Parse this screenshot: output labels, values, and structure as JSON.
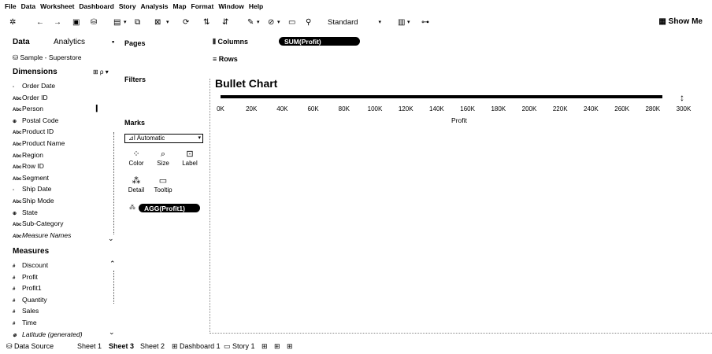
{
  "menu": [
    "File",
    "Data",
    "Worksheet",
    "Dashboard",
    "Story",
    "Analysis",
    "Map",
    "Format",
    "Window",
    "Help"
  ],
  "toolbar": {
    "icons": [
      "tableau-logo-icon",
      "back-icon",
      "forward-icon",
      "save-icon",
      "new-datasource-icon",
      "new-sheet-icon",
      "duplicate-icon",
      "clear-icon",
      "swap-icon",
      "sort-asc-icon",
      "sort-desc-icon",
      "highlight-icon",
      "group-icon",
      "label-icon",
      "pin-icon"
    ],
    "fit_select": "Standard",
    "show_me": "Show Me"
  },
  "datapane": {
    "tab_data": "Data",
    "tab_analytics": "Analytics",
    "datasource": "Sample - Superstore",
    "dimensions_header": "Dimensions",
    "dimensions": [
      {
        "icon": "▫",
        "label": "Order Date",
        "italic": false
      },
      {
        "icon": "Abc",
        "label": "Order ID",
        "italic": false
      },
      {
        "icon": "Abc",
        "label": "Person",
        "italic": false
      },
      {
        "icon": "⊕",
        "label": "Postal Code",
        "italic": false
      },
      {
        "icon": "Abc",
        "label": "Product ID",
        "italic": false
      },
      {
        "icon": "Abc",
        "label": "Product Name",
        "italic": false
      },
      {
        "icon": "Abc",
        "label": "Region",
        "italic": false
      },
      {
        "icon": "Abc",
        "label": "Row ID",
        "italic": false
      },
      {
        "icon": "Abc",
        "label": "Segment",
        "italic": false
      },
      {
        "icon": "▫",
        "label": "Ship Date",
        "italic": false
      },
      {
        "icon": "Abc",
        "label": "Ship Mode",
        "italic": false
      },
      {
        "icon": "⊕",
        "label": "State",
        "italic": false
      },
      {
        "icon": "Abc",
        "label": "Sub-Category",
        "italic": false
      },
      {
        "icon": "Abc",
        "label": "Measure Names",
        "italic": true
      }
    ],
    "measures_header": "Measures",
    "measures": [
      {
        "icon": "#",
        "label": "Discount",
        "italic": false
      },
      {
        "icon": "#",
        "label": "Profit",
        "italic": false
      },
      {
        "icon": "#",
        "label": "Profit1",
        "italic": false
      },
      {
        "icon": "#",
        "label": "Quantity",
        "italic": false
      },
      {
        "icon": "#",
        "label": "Sales",
        "italic": false
      },
      {
        "icon": "#",
        "label": "Time",
        "italic": false
      },
      {
        "icon": "⊕",
        "label": "Latitude (generated)",
        "italic": true
      }
    ]
  },
  "cards": {
    "pages": "Pages",
    "filters": "Filters",
    "marks": "Marks",
    "mark_type": "Automatic",
    "mark_buttons": [
      "Color",
      "Size",
      "Label",
      "Detail",
      "Tooltip"
    ],
    "marks_pill": "AGG(Profit1)"
  },
  "shelves": {
    "columns_label": "Columns",
    "columns_pill": "SUM(Profit)",
    "rows_label": "Rows"
  },
  "chart": {
    "title": "Bullet Chart"
  },
  "chart_data": {
    "type": "bar",
    "title": "Bullet Chart",
    "xlabel": "Profit",
    "ylabel": "",
    "categories": [
      ""
    ],
    "values": [
      286000
    ],
    "xlim": [
      0,
      300000
    ],
    "tick_labels": [
      "0K",
      "20K",
      "40K",
      "60K",
      "80K",
      "100K",
      "120K",
      "140K",
      "160K",
      "180K",
      "200K",
      "220K",
      "240K",
      "260K",
      "280K",
      "300K"
    ],
    "grid": false
  },
  "tabs": {
    "data_source": "Data Source",
    "sheets": [
      "Sheet 1",
      "Sheet 3",
      "Sheet 2",
      "Dashboard 1",
      "Story 1"
    ],
    "active": "Sheet 3"
  }
}
